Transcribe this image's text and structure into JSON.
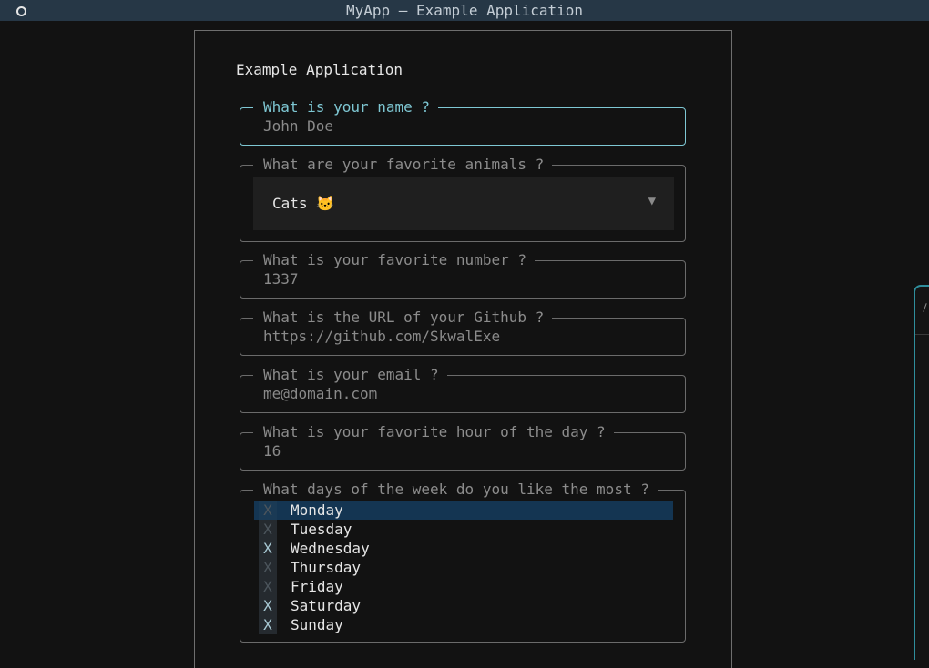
{
  "window": {
    "title": "MyApp — Example Application"
  },
  "form": {
    "title": "Example Application",
    "name_field": {
      "label": "What is your name ?",
      "value": "John Doe"
    },
    "animals_field": {
      "label": "What are your favorite animals ?",
      "selected": "Cats 🐱"
    },
    "number_field": {
      "label": "What is your favorite number ?",
      "value": "1337"
    },
    "github_field": {
      "label": "What is the URL of your Github ?",
      "value": "https://github.com/SkwalExe"
    },
    "email_field": {
      "label": "What is your email ?",
      "value": "me@domain.com"
    },
    "hour_field": {
      "label": "What is your favorite hour of the day ?",
      "value": "16"
    },
    "days_field": {
      "label": "What days of the week do you like the most ?",
      "check_mark": "X",
      "options": [
        {
          "label": "Monday",
          "checked": false,
          "highlighted": true
        },
        {
          "label": "Tuesday",
          "checked": false,
          "highlighted": false
        },
        {
          "label": "Wednesday",
          "checked": true,
          "highlighted": false
        },
        {
          "label": "Thursday",
          "checked": false,
          "highlighted": false
        },
        {
          "label": "Friday",
          "checked": false,
          "highlighted": false
        },
        {
          "label": "Saturday",
          "checked": true,
          "highlighted": false
        },
        {
          "label": "Sunday",
          "checked": true,
          "highlighted": false
        }
      ]
    }
  },
  "colors": {
    "accent": "#7ec7d3",
    "highlight_row": "#143552",
    "titlebar": "#263746"
  },
  "icons": {
    "window_control": "circle-icon",
    "dropdown": "triangle-down-icon"
  }
}
